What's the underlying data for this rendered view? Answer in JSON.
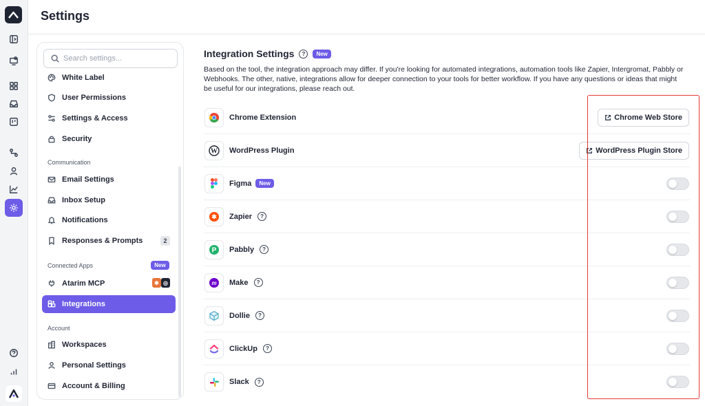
{
  "header": {
    "title": "Settings"
  },
  "search": {
    "placeholder": "Search settings..."
  },
  "sidebar": {
    "items": [
      {
        "label": "White Label"
      },
      {
        "label": "User Permissions"
      },
      {
        "label": "Settings & Access"
      },
      {
        "label": "Security"
      },
      {
        "label": "Email Settings"
      },
      {
        "label": "Inbox Setup"
      },
      {
        "label": "Notifications"
      },
      {
        "label": "Responses & Prompts",
        "count": "2"
      },
      {
        "label": "Atarim MCP"
      },
      {
        "label": "Integrations"
      },
      {
        "label": "Workspaces"
      },
      {
        "label": "Personal Settings"
      },
      {
        "label": "Account & Billing"
      }
    ],
    "sections": {
      "communication": "Communication",
      "connected_apps": "Connected Apps",
      "account": "Account"
    },
    "connected_apps_badge": "New"
  },
  "main": {
    "title": "Integration Settings",
    "title_badge": "New",
    "description": "Based on the tool, the integration approach may differ. If you're looking for automated integrations, automation tools like Zapier, Intergromat, Pabbly or Webhooks. The other, native, integrations allow for deeper connection to your tools for better workflow. If you have any questions or ideas that might be useful for our integrations, please reach out.",
    "integrations": [
      {
        "name": "Chrome Extension",
        "action": "Chrome Web Store",
        "icon": "chrome-icon"
      },
      {
        "name": "WordPress Plugin",
        "action": "WordPress Plugin Store",
        "icon": "wordpress-icon"
      },
      {
        "name": "Figma",
        "badge": "New",
        "enabled": false,
        "icon": "figma-icon"
      },
      {
        "name": "Zapier",
        "enabled": false,
        "icon": "zapier-icon"
      },
      {
        "name": "Pabbly",
        "enabled": false,
        "icon": "pabbly-icon"
      },
      {
        "name": "Make",
        "enabled": false,
        "icon": "make-icon"
      },
      {
        "name": "Dollie",
        "enabled": false,
        "icon": "dollie-icon"
      },
      {
        "name": "ClickUp",
        "enabled": false,
        "icon": "clickup-icon"
      },
      {
        "name": "Slack",
        "enabled": false,
        "icon": "slack-icon"
      }
    ]
  },
  "colors": {
    "accent": "#6d5ce7",
    "highlight": "#e53935"
  }
}
